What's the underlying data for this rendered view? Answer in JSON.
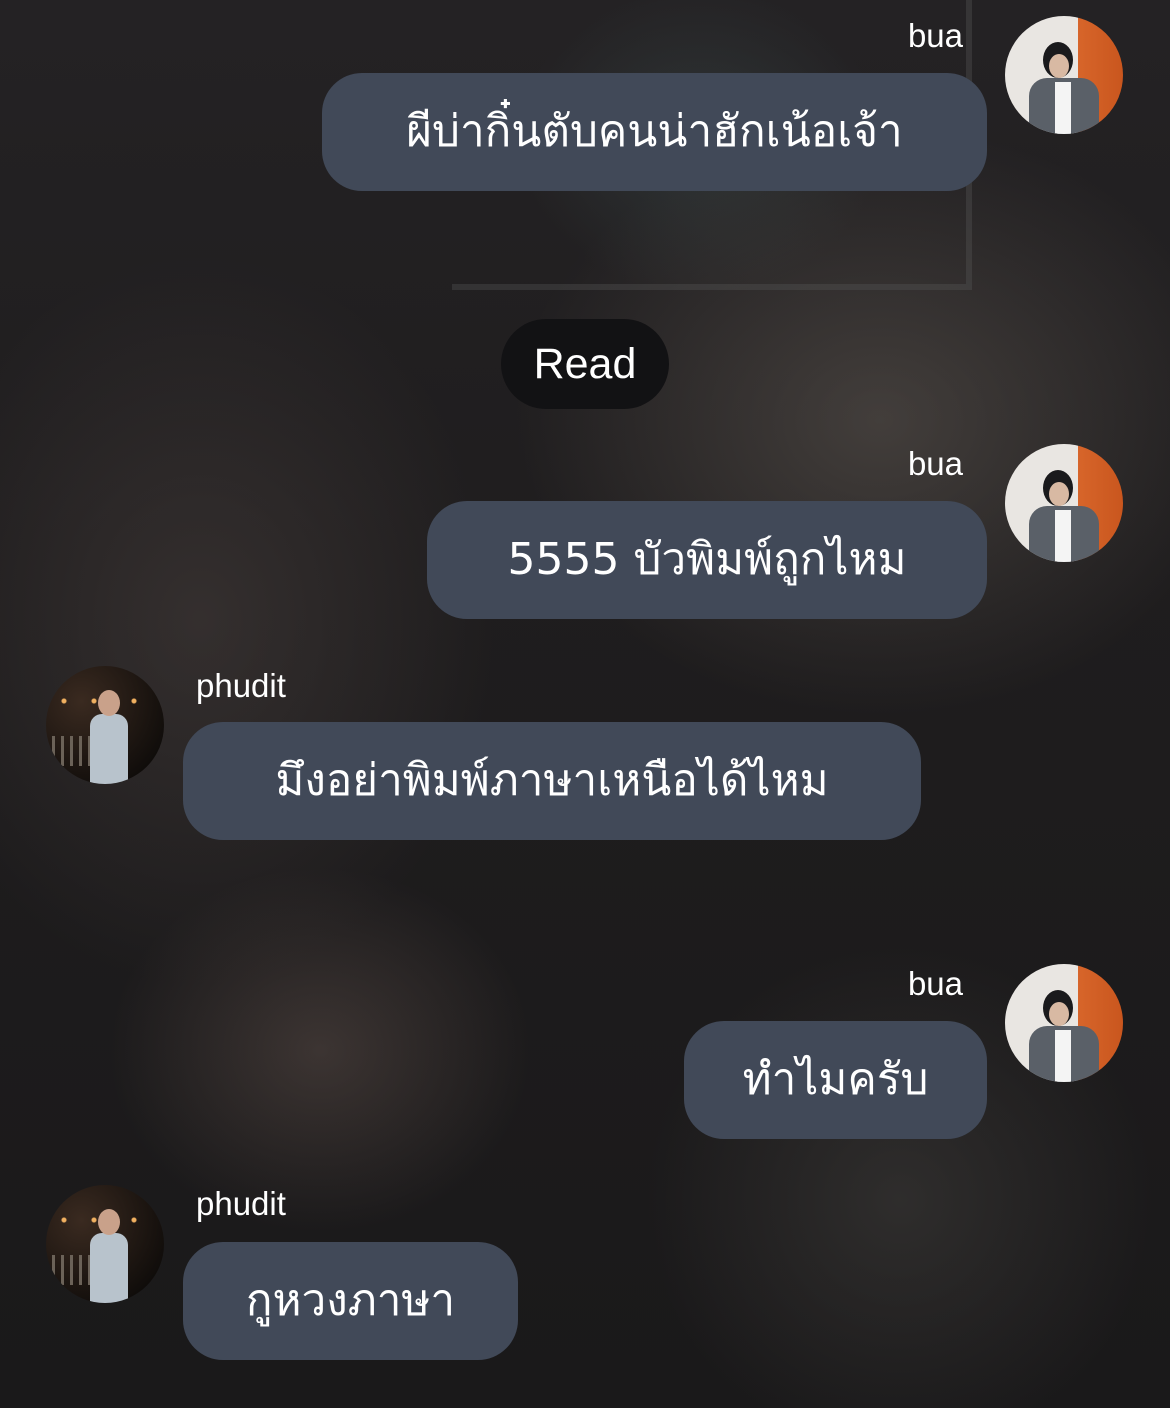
{
  "messages": [
    {
      "sender": "bua",
      "text": "ผีบ่ากิ๋นตับคนน่าฮักเน้อเจ้า",
      "side": "right"
    },
    {
      "sender": "bua",
      "text": "5555 บัวพิมพ์ถูกไหม",
      "side": "right"
    },
    {
      "sender": "phudit",
      "text": "มึงอย่าพิมพ์ภาษาเหนือได้ไหม",
      "side": "left"
    },
    {
      "sender": "bua",
      "text": "ทำไมครับ",
      "side": "right"
    },
    {
      "sender": "phudit",
      "text": "กูหวงภาษา",
      "side": "left"
    }
  ],
  "read_status": "Read",
  "colors": {
    "bubble": "#414958",
    "read_pill": "#121214",
    "text": "#ffffff"
  }
}
